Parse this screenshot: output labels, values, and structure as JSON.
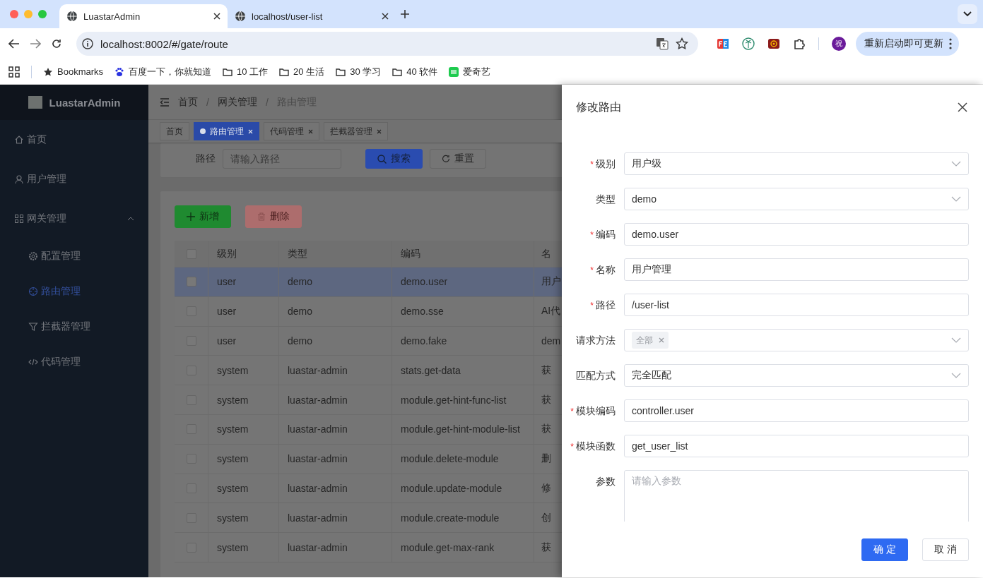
{
  "browser": {
    "tabs": [
      {
        "title": "LuastarAdmin",
        "selected": true
      },
      {
        "title": "localhost/user-list",
        "selected": false
      }
    ],
    "address": "localhost:8002/#/gate/route",
    "avatar": "祝",
    "update_button": "重新启动即可更新",
    "bookmarks": [
      {
        "kind": "star",
        "label": "Bookmarks"
      },
      {
        "kind": "paw",
        "label": "百度一下，你就知道"
      },
      {
        "kind": "folder",
        "label": "10 工作"
      },
      {
        "kind": "folder",
        "label": "20 生活"
      },
      {
        "kind": "folder",
        "label": "30 学习"
      },
      {
        "kind": "folder",
        "label": "40 软件"
      },
      {
        "kind": "app",
        "label": "爱奇艺"
      }
    ]
  },
  "app": {
    "logo": "LuastarAdmin",
    "sidebar": {
      "items": [
        {
          "label": "首页",
          "selected": false
        },
        {
          "label": "用户管理",
          "selected": false
        },
        {
          "label": "网关管理",
          "selected": false,
          "expanded": true,
          "children": [
            {
              "label": "配置管理",
              "selected": false
            },
            {
              "label": "路由管理",
              "selected": true
            },
            {
              "label": "拦截器管理",
              "selected": false
            },
            {
              "label": "代码管理",
              "selected": false
            }
          ]
        }
      ]
    },
    "breadcrumb": [
      "首页",
      "网关管理",
      "路由管理"
    ],
    "breadcrumb_separator": "/",
    "tags": [
      {
        "label": "首页",
        "selected": false,
        "closable": false
      },
      {
        "label": "路由管理",
        "selected": true,
        "closable": true
      },
      {
        "label": "代码管理",
        "selected": false,
        "closable": true
      },
      {
        "label": "拦截器管理",
        "selected": false,
        "closable": true
      }
    ],
    "search": {
      "label": "路径",
      "placeholder": "请输入路径",
      "search_button": "搜索",
      "reset_button": "重置"
    },
    "toolbar": {
      "add_button": "新增",
      "delete_button": {
        "label": "删除",
        "disabled": true
      }
    },
    "table": {
      "columns": [
        "级别",
        "类型",
        "编码",
        "名"
      ],
      "header_checked": false,
      "rows": [
        {
          "checked": false,
          "selected": true,
          "cells": [
            "user",
            "demo",
            "demo.user",
            "用户"
          ]
        },
        {
          "checked": false,
          "selected": false,
          "cells": [
            "user",
            "demo",
            "demo.sse",
            "AI代"
          ]
        },
        {
          "checked": false,
          "selected": false,
          "cells": [
            "user",
            "demo",
            "demo.fake",
            "dem"
          ]
        },
        {
          "checked": false,
          "selected": false,
          "cells": [
            "system",
            "luastar-admin",
            "stats.get-data",
            "获"
          ]
        },
        {
          "checked": false,
          "selected": false,
          "cells": [
            "system",
            "luastar-admin",
            "module.get-hint-func-list",
            "获"
          ]
        },
        {
          "checked": false,
          "selected": false,
          "cells": [
            "system",
            "luastar-admin",
            "module.get-hint-module-list",
            "获"
          ]
        },
        {
          "checked": false,
          "selected": false,
          "cells": [
            "system",
            "luastar-admin",
            "module.delete-module",
            "删"
          ]
        },
        {
          "checked": false,
          "selected": false,
          "cells": [
            "system",
            "luastar-admin",
            "module.update-module",
            "修"
          ]
        },
        {
          "checked": false,
          "selected": false,
          "cells": [
            "system",
            "luastar-admin",
            "module.create-module",
            "创"
          ]
        },
        {
          "checked": false,
          "selected": false,
          "cells": [
            "system",
            "luastar-admin",
            "module.get-max-rank",
            "获"
          ]
        }
      ]
    }
  },
  "drawer": {
    "title": "修改路由",
    "required_mark": "*",
    "fields": [
      {
        "kind": "select",
        "label": "级别",
        "required": true,
        "value": "用户级"
      },
      {
        "kind": "select",
        "label": "类型",
        "required": false,
        "value": "demo"
      },
      {
        "kind": "input",
        "label": "编码",
        "required": true,
        "value": "demo.user"
      },
      {
        "kind": "input",
        "label": "名称",
        "required": true,
        "value": "用户管理"
      },
      {
        "kind": "input",
        "label": "路径",
        "required": true,
        "value": "/user-list"
      },
      {
        "kind": "tags",
        "label": "请求方法",
        "required": false,
        "tags": [
          "全部"
        ]
      },
      {
        "kind": "select",
        "label": "匹配方式",
        "required": false,
        "value": "完全匹配"
      },
      {
        "kind": "input",
        "label": "模块编码",
        "required": true,
        "value": "controller.user"
      },
      {
        "kind": "input",
        "label": "模块函数",
        "required": true,
        "value": "get_user_list"
      },
      {
        "kind": "textarea",
        "label": "参数",
        "required": false,
        "placeholder": "请输入参数"
      }
    ],
    "buttons": [
      {
        "kind": "primary",
        "label": "确 定"
      },
      {
        "kind": "default",
        "label": "取 消"
      }
    ]
  }
}
